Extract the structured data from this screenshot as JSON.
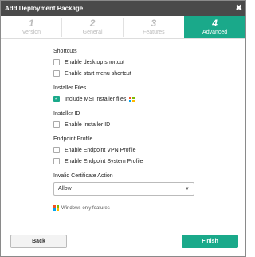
{
  "dialog": {
    "title": "Add Deployment Package",
    "close": "✖"
  },
  "steps": [
    {
      "num": "1",
      "label": "Version",
      "active": false
    },
    {
      "num": "2",
      "label": "General",
      "active": false
    },
    {
      "num": "3",
      "label": "Features",
      "active": false
    },
    {
      "num": "4",
      "label": "Advanced",
      "active": true
    }
  ],
  "sections": {
    "shortcuts": {
      "title": "Shortcuts",
      "options": [
        {
          "label": "Enable desktop shortcut",
          "checked": false
        },
        {
          "label": "Enable start menu shortcut",
          "checked": false
        }
      ]
    },
    "installer_files": {
      "title": "Installer Files",
      "options": [
        {
          "label": "Include MSI installer files",
          "checked": true
        }
      ]
    },
    "installer_id": {
      "title": "Installer ID",
      "options": [
        {
          "label": "Enable Installer ID",
          "checked": false
        }
      ]
    },
    "endpoint_profile": {
      "title": "Endpoint Profile",
      "options": [
        {
          "label": "Enable Endpoint VPN Profile",
          "checked": false
        },
        {
          "label": "Enable Endpoint System Profile",
          "checked": false
        }
      ]
    },
    "certificate": {
      "title": "Invalid Certificate Action",
      "selected": "Allow"
    }
  },
  "note": "Windows-only features",
  "buttons": {
    "back": "Back",
    "finish": "Finish"
  },
  "colors": {
    "accent": "#1aa98a",
    "titlebar": "#4a4a4a"
  }
}
